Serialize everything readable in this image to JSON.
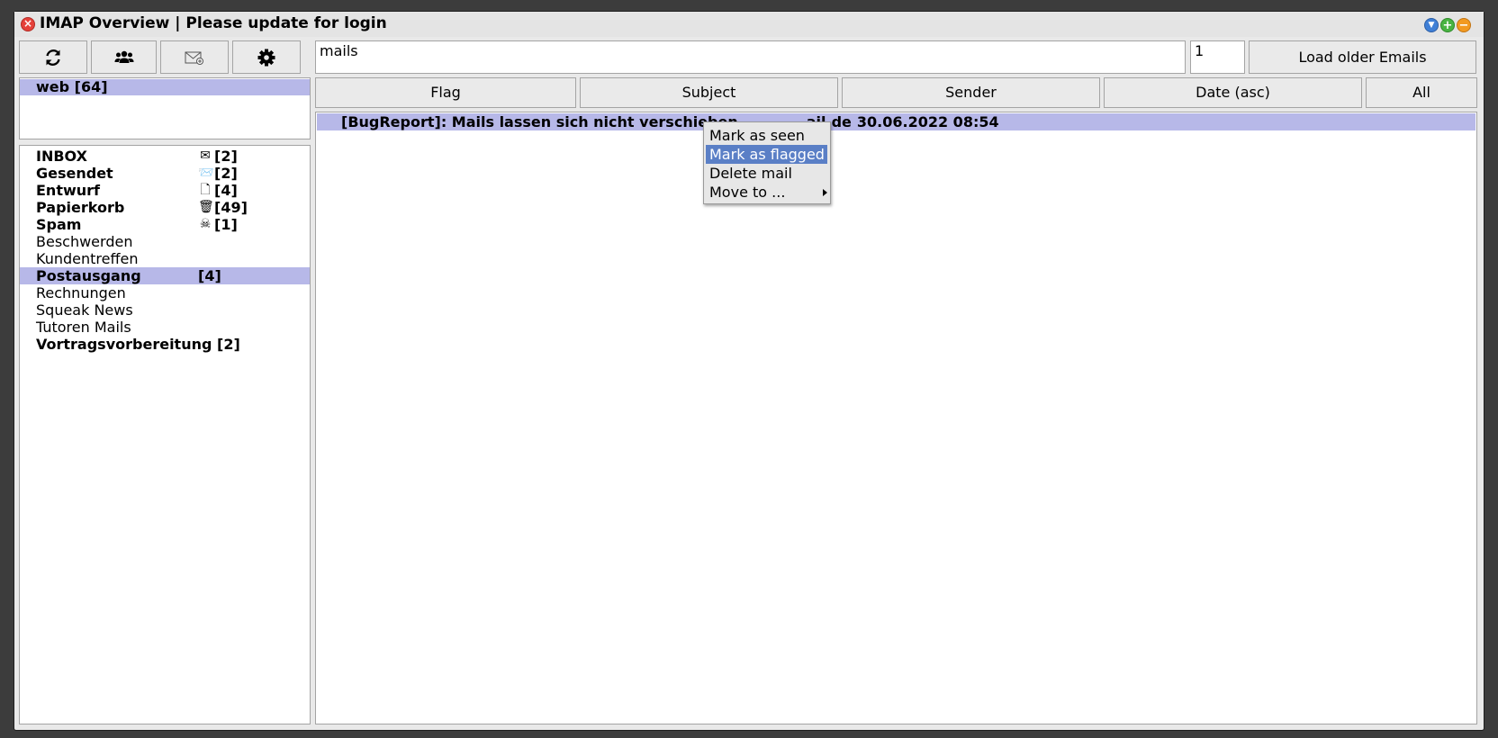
{
  "window": {
    "title": "IMAP Overview | Please update for login"
  },
  "toolbar": {
    "search_value": "mails",
    "count_value": "1",
    "load_older_label": "Load older Emails",
    "icons": [
      "refresh-icon",
      "users-icon",
      "new-mail-icon",
      "gear-icon"
    ]
  },
  "accounts": [
    {
      "label": "web [64]",
      "selected": true
    }
  ],
  "folders": [
    {
      "name": "INBOX",
      "bold": true,
      "icon": "✉",
      "count": "[2]",
      "selected": false
    },
    {
      "name": "Gesendet",
      "bold": true,
      "icon": "📨",
      "count": "[2]",
      "selected": false
    },
    {
      "name": "Entwurf",
      "bold": true,
      "icon": "🗋",
      "count": "[4]",
      "selected": false
    },
    {
      "name": "Papierkorb",
      "bold": true,
      "icon": "🗑",
      "count": "[49]",
      "selected": false
    },
    {
      "name": "Spam",
      "bold": true,
      "icon": "☠",
      "count": "[1]",
      "selected": false
    },
    {
      "name": "Beschwerden",
      "bold": false,
      "icon": "",
      "count": "",
      "selected": false
    },
    {
      "name": "Kundentreffen",
      "bold": false,
      "icon": "",
      "count": "",
      "selected": false
    },
    {
      "name": "Postausgang",
      "bold": true,
      "icon": "",
      "count": "[4]",
      "selected": true
    },
    {
      "name": "Rechnungen",
      "bold": false,
      "icon": "",
      "count": "",
      "selected": false
    },
    {
      "name": "Squeak News",
      "bold": false,
      "icon": "",
      "count": "",
      "selected": false
    },
    {
      "name": "Tutoren Mails",
      "bold": false,
      "icon": "",
      "count": "",
      "selected": false
    },
    {
      "name": "Vortragsvorbereitung [2]",
      "bold": true,
      "icon": "",
      "count": "",
      "selected": false
    }
  ],
  "sort_buttons": {
    "flag": "Flag",
    "subject": "Subject",
    "sender": "Sender",
    "date": "Date (asc)",
    "all": "All"
  },
  "mails": [
    {
      "subject": "[BugReport]: Mails lassen sich nicht verschieben",
      "sender": "ail.de",
      "date": "30.06.2022 08:54"
    }
  ],
  "context_menu": {
    "items": [
      {
        "label": "Mark as seen",
        "active": false
      },
      {
        "label": "Mark as flagged",
        "active": true
      },
      {
        "label": "Delete mail",
        "active": false
      },
      {
        "label": "Move to ...",
        "active": false,
        "submenu": true
      }
    ]
  },
  "colors": {
    "selection": "#b7b8e8",
    "menu_highlight": "#5a7fc6"
  }
}
